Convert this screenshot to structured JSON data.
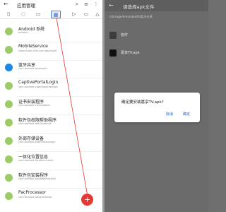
{
  "left": {
    "title": "应用管理",
    "back_icon": "arrow-left-icon",
    "tabs": [
      {
        "icon": "phone-icon",
        "glyph": "▯"
      },
      {
        "icon": "android-icon",
        "glyph": "◌"
      },
      {
        "icon": "folder-icon",
        "glyph": "▭"
      },
      {
        "icon": "grid-icon",
        "glyph": "▦",
        "selected": true
      },
      {
        "icon": "play-icon",
        "glyph": "▷"
      },
      {
        "icon": "folder-outline-icon",
        "glyph": "▭"
      },
      {
        "icon": "warning-icon",
        "glyph": "△"
      }
    ],
    "apps": [
      {
        "name": "Android 系统",
        "pkg": "android",
        "icon_color": "#9ccc65"
      },
      {
        "name": "MobileService",
        "pkg": "cases.tools.mtv.com.backlight",
        "icon_color": "#9ccc65"
      },
      {
        "name": "蓝牙共享",
        "pkg": "com.android.bluetooth",
        "icon_color": "#1e88e5"
      },
      {
        "name": "CaptivePortalLogin",
        "pkg": "com.android.captiveportallogin",
        "icon_color": "#9ccc65"
      },
      {
        "name": "证书安装程序",
        "pkg": "com.android.certinstaller",
        "icon_color": "#9ccc65"
      },
      {
        "name": "软件包权限帮助程序",
        "pkg": "com.android.defcontainer",
        "icon_color": "#9ccc65"
      },
      {
        "name": "外部存储设备",
        "pkg": "com.android.externalstorage",
        "icon_color": "#9ccc65"
      },
      {
        "name": "一体化位置信息",
        "pkg": "com.android.location.fused",
        "icon_color": "#9ccc65"
      },
      {
        "name": "软件包安装程序",
        "pkg": "com.android.packageinstaller",
        "icon_color": "#9ccc65"
      },
      {
        "name": "PacProcessor",
        "pkg": "com.android.pacprocessor",
        "icon_color": "#9ccc65"
      }
    ],
    "fab_label": "+"
  },
  "right": {
    "title": "请选择apk文件",
    "back_icon": "arrow-left-icon",
    "path": "/storage/emulated/0/蓝牙分享",
    "items": [
      {
        "name": "软件",
        "type": "folder"
      },
      {
        "name": "嘉享TV.apk",
        "type": "apk"
      }
    ]
  },
  "dialog": {
    "message": "确定要安装嘉享TV.apk?",
    "cancel_label": "取消",
    "ok_label": "确定"
  }
}
